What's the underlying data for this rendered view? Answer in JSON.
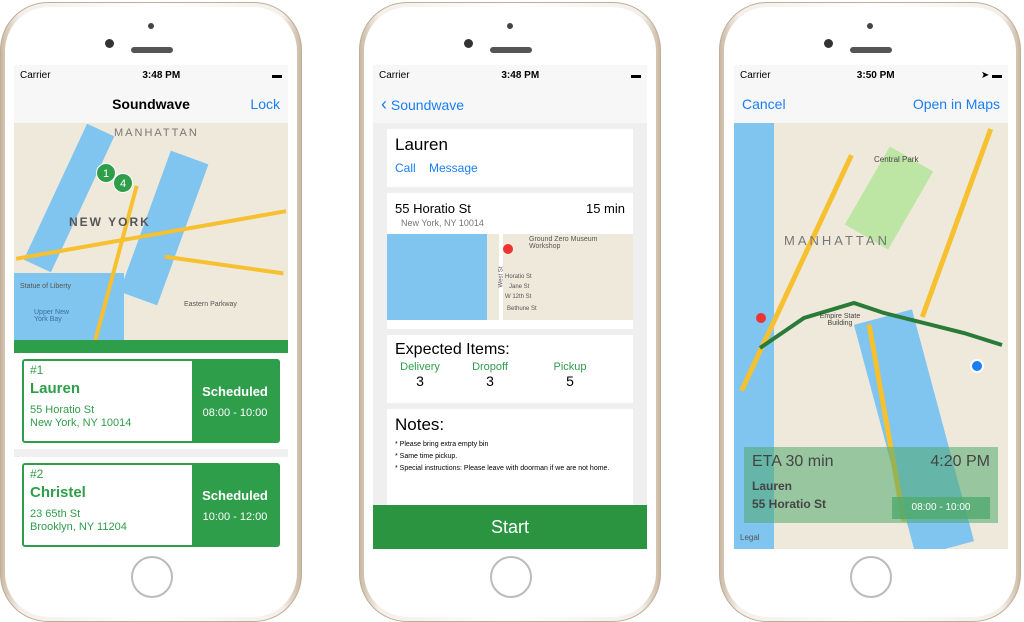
{
  "phone1": {
    "status": {
      "carrier": "Carrier",
      "time": "3:48 PM"
    },
    "nav": {
      "title": "Soundwave",
      "right": "Lock"
    },
    "map": {
      "labels": [
        "MANHATTAN",
        "NEW YORK",
        "Statue of Liberty",
        "Eastern Parkway",
        "Upper New York Bay"
      ],
      "pins": [
        "1",
        "4"
      ]
    },
    "jobs": [
      {
        "num": "#1",
        "name": "Lauren",
        "street": "55 Horatio St",
        "city": "New York, NY 10014",
        "status": "Scheduled",
        "window": "08:00 - 10:00"
      },
      {
        "num": "#2",
        "name": "Christel",
        "street": "23 65th St",
        "city": "Brooklyn, NY 11204",
        "status": "Scheduled",
        "window": "10:00 - 12:00"
      }
    ]
  },
  "phone2": {
    "status": {
      "carrier": "Carrier",
      "time": "3:48 PM"
    },
    "nav": {
      "back": "Soundwave"
    },
    "contact": {
      "name": "Lauren",
      "call": "Call",
      "message": "Message"
    },
    "address": {
      "street": "55 Horatio St",
      "city": "New York, NY 10014",
      "duration": "15 min",
      "map_labels": [
        "Ground Zero Museum Workshop",
        "Horatio St",
        "Jane St",
        "W 12th St",
        "Bethune St",
        "West St"
      ]
    },
    "expected": {
      "title": "Expected Items:",
      "items": [
        {
          "label": "Delivery",
          "count": "3"
        },
        {
          "label": "Dropoff",
          "count": "3"
        },
        {
          "label": "Pickup",
          "count": "5"
        }
      ]
    },
    "notes": {
      "title": "Notes:",
      "lines": [
        "* Please bring extra empty bin",
        "* Same time pickup.",
        "* Special instructions: Please leave with doorman if we are not home."
      ]
    },
    "start": "Start"
  },
  "phone3": {
    "status": {
      "carrier": "Carrier",
      "time": "3:50 PM"
    },
    "nav": {
      "left": "Cancel",
      "right": "Open in Maps"
    },
    "map": {
      "labels": [
        "MANHATTAN",
        "Central Park",
        "Empire State Building",
        "Legal"
      ]
    },
    "eta": {
      "eta": "ETA 30 min",
      "arrival": "4:20 PM",
      "name": "Lauren",
      "street": "55 Horatio St",
      "window": "08:00 - 10:00"
    }
  },
  "colors": {
    "green": "#2f9e4a",
    "blue": "#1a7ef5",
    "route": "#2a7a38"
  }
}
